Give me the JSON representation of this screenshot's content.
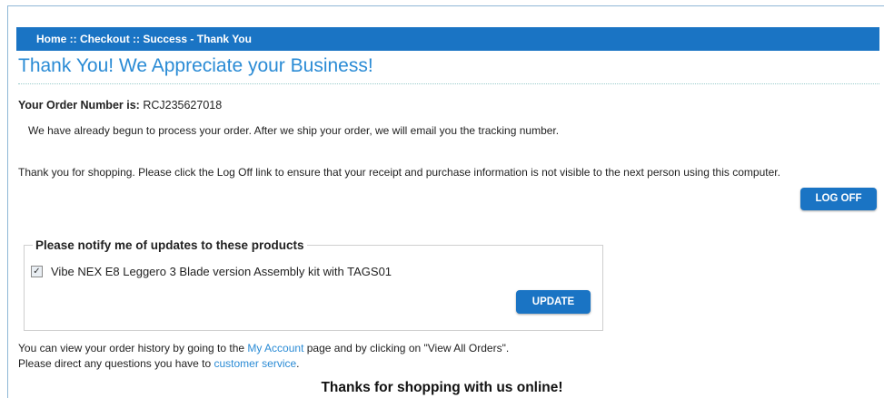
{
  "breadcrumb": {
    "home": "Home",
    "sep1": " :: ",
    "checkout": "Checkout",
    "sep2": " :: ",
    "current": "Success - Thank You"
  },
  "page_title": "Thank You! We Appreciate your Business!",
  "order": {
    "label": "Your Order Number is:",
    "number": "RCJ235627018"
  },
  "processing_text": "We have already begun to process your order.  After we ship your order, we will email you the tracking number.",
  "logoff_text": "Thank you for shopping. Please click the Log Off link to ensure that your receipt and purchase information is not visible to the next person using this computer.",
  "logoff_button": "LOG OFF",
  "notify": {
    "legend": "Please notify me of updates to these products",
    "checked": "✓",
    "product": "Vibe NEX E8 Leggero 3 Blade version Assembly kit with TAGS01",
    "update_button": "UPDATE"
  },
  "history": {
    "line1_pre": "You can view your order history by going to the ",
    "my_account_link": "My Account",
    "line1_post": " page and by clicking on \"View All Orders\".",
    "line2_pre": "Please direct any questions you have to ",
    "customer_service_link": "customer service",
    "line2_post": "."
  },
  "footer_thanks": "Thanks for shopping with us online!"
}
